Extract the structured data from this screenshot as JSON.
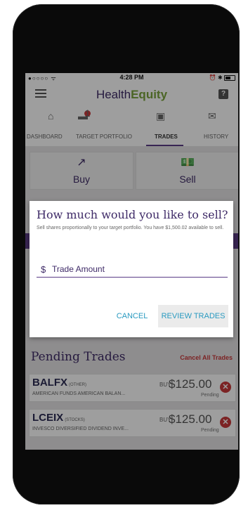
{
  "status_bar": {
    "carrier": "●○○○○ ᯤ",
    "time": "4:28 PM",
    "right": "⏰ ✱"
  },
  "header": {
    "logo_main": "Health",
    "logo_accent": "Equity",
    "help": "?"
  },
  "icons": {
    "home": "⌂",
    "wallet": "▬",
    "wallet_badge": "1",
    "account": "▣",
    "mail": "✉"
  },
  "tabs": [
    {
      "label": "DASHBOARD"
    },
    {
      "label": "TARGET PORTFOLIO"
    },
    {
      "label": "TRADES"
    },
    {
      "label": "HISTORY"
    }
  ],
  "cards": [
    {
      "label": "Buy",
      "icon": "↗"
    },
    {
      "label": "Sell",
      "icon": "💵"
    }
  ],
  "dialog": {
    "title": "How much would you like to sell?",
    "text": "Sell shares proportionally to your target portfolio. You have $1,500.02 available to sell.",
    "currency": "$",
    "placeholder": "Trade Amount",
    "cancel": "CANCEL",
    "review": "REVIEW TRADES"
  },
  "pending": {
    "title": "Pending Trades",
    "cancel_all": "Cancel All Trades",
    "rows": [
      {
        "symbol": "BALFX",
        "class": "(OTHER)",
        "desc": "AMERICAN FUNDS AMERICAN BALAN...",
        "type": "BUY",
        "amount": "$125.00",
        "status": "Pending"
      },
      {
        "symbol": "LCEIX",
        "class": "(STOCKS)",
        "desc": "INVESCO DIVERSIFIED DIVIDEND INVE...",
        "type": "BUY",
        "amount": "$125.00",
        "status": "Pending"
      }
    ]
  },
  "colors": {
    "brand_purple": "#3e2a67",
    "brand_green": "#7aa33d",
    "danger": "#c8393b",
    "link": "#2a9ac0"
  }
}
